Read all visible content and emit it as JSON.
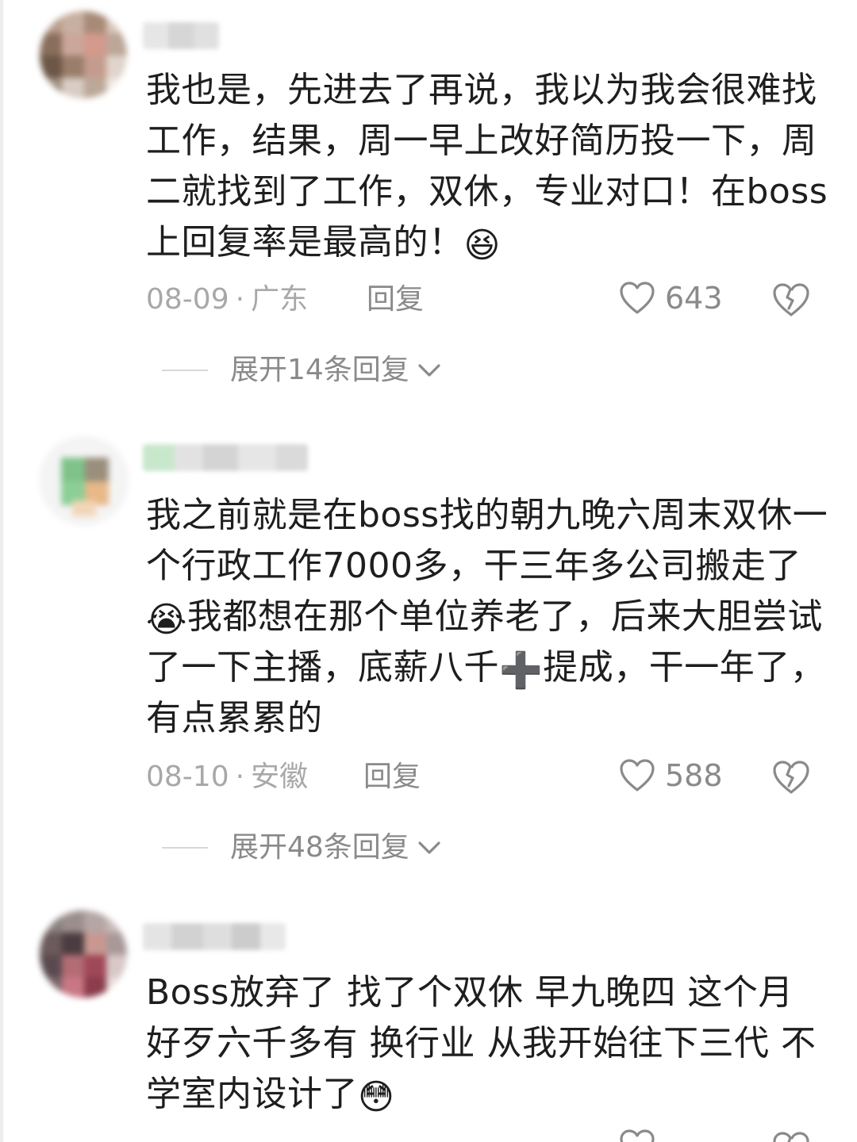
{
  "comments": [
    {
      "text": "我也是，先进去了再说，我以为我会很难找工作，结果，周一早上改好简历投一下，周二就找到了工作，双休，专业对口！在boss上回复率是最高的！",
      "emoji": "😆",
      "date": "08-09",
      "location": "广东",
      "reply_label": "回复",
      "likes": "643",
      "expand_label": "展开14条回复"
    },
    {
      "text_before": "我之前就是在boss找的朝九晚六周末双休一个行政工作7000多，干三年多公司搬走了",
      "emoji_mid": "😭",
      "text_middle": "我都想在那个单位养老了，后来大胆尝试了一下主播，底薪八千",
      "emoji_plus": "➕",
      "text_after": "提成，干一年了，有点累累的",
      "date": "08-10",
      "location": "安徽",
      "reply_label": "回复",
      "likes": "588",
      "expand_label": "展开48条回复"
    },
    {
      "text": "Boss放弃了 找了个双休 早九晚四 这个月好歹六千多有 换行业 从我开始往下三代 不学室内设计了",
      "emoji": "😳"
    }
  ],
  "icons": {
    "like": "heart-outline-icon",
    "dislike": "broken-heart-icon",
    "expand": "chevron-down-icon"
  }
}
